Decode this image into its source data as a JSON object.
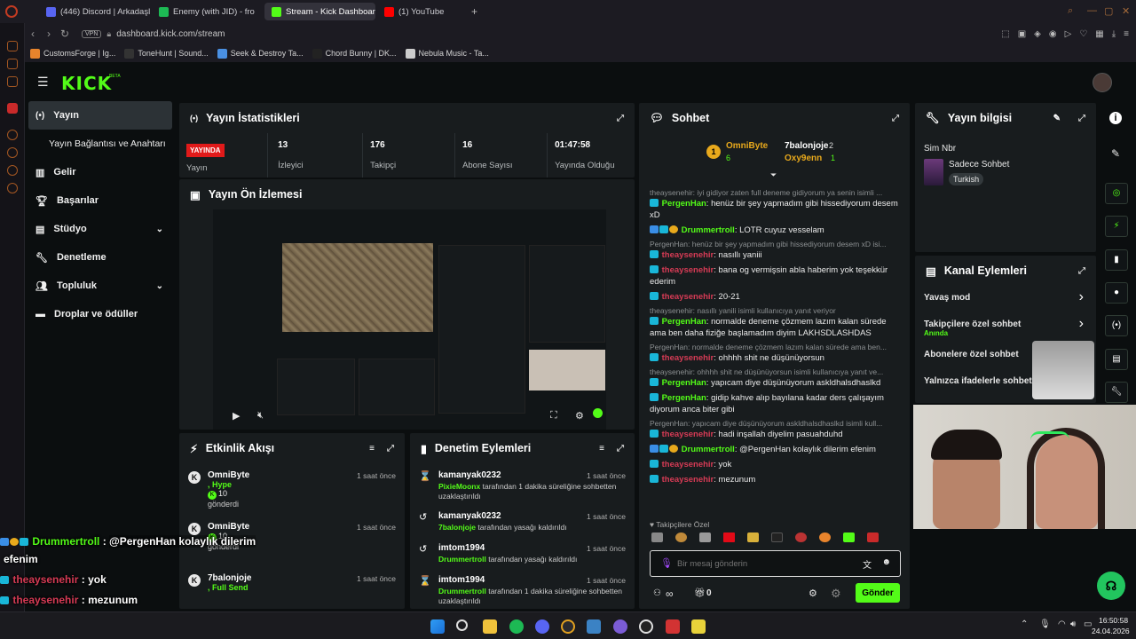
{
  "browser": {
    "tabs": [
      {
        "label": "(446) Discord | Arkadaşlar",
        "color": "#5865f2"
      },
      {
        "label": "Enemy (with JID) - fro",
        "color": "#1db954"
      },
      {
        "label": "Stream - Kick Dashboard",
        "color": "#53fc18"
      },
      {
        "label": "(1) YouTube",
        "color": "#ff0000"
      }
    ],
    "new_tab": "+",
    "url": "dashboard.kick.com/stream",
    "vpn": "VPN",
    "bookmarks": [
      "CustomsForge | Ig...",
      "ToneHunt | Sound...",
      "Seek & Destroy Ta...",
      "Chord Bunny | DK...",
      "Nebula Music - Ta..."
    ]
  },
  "kick": {
    "logo": "KICK",
    "beta": "BETA",
    "accent": "#53fc18"
  },
  "sidenav": {
    "items": [
      {
        "label": "Yayın",
        "icon": "broadcast-icon"
      },
      {
        "label": "Yayın Bağlantısı ve Anahtarı",
        "icon": ""
      },
      {
        "label": "Gelir",
        "icon": "chart-icon"
      },
      {
        "label": "Başarılar",
        "icon": "trophy-icon"
      },
      {
        "label": "Stüdyo",
        "icon": "studio-icon"
      },
      {
        "label": "Denetleme",
        "icon": "wrench-icon"
      },
      {
        "label": "Topluluk",
        "icon": "people-icon"
      },
      {
        "label": "Droplar ve ödüller",
        "icon": "gift-icon"
      }
    ]
  },
  "stats": {
    "title": "Yayın İstatistikleri",
    "live_badge": "YAYINDA",
    "live_label": "Yayın",
    "items": [
      {
        "value": "13",
        "label": "İzleyici"
      },
      {
        "value": "176",
        "label": "Takipçi"
      },
      {
        "value": "16",
        "label": "Abone Sayısı"
      },
      {
        "value": "01:47:58",
        "label": "Yayında Olduğu"
      }
    ]
  },
  "preview": {
    "title": "Yayın Ön İzlemesi"
  },
  "activity": {
    "title": "Etkinlik Akışı",
    "items": [
      {
        "user": "OmniByte",
        "action": ", Hype",
        "amount": "10",
        "suffix": "gönderdi",
        "time": "1 saat önce"
      },
      {
        "user": "OmniByte",
        "action": "",
        "amount": "10",
        "suffix": "gönderdi",
        "time": "1 saat önce"
      },
      {
        "user": "7balonjoje",
        "action": ", Full Send",
        "amount": "",
        "suffix": "",
        "time": "1 saat önce"
      }
    ]
  },
  "moderation": {
    "title": "Denetim Eylemleri",
    "items": [
      {
        "user": "kamanyak0232",
        "actor": "PixieMoonx",
        "text": "tarafından 1 dakika süreliğine sohbetten uzaklaştırıldı",
        "time": "1 saat önce"
      },
      {
        "user": "kamanyak0232",
        "actor": "7balonjoje",
        "text": "tarafından yasağı kaldırıldı",
        "time": "1 saat önce"
      },
      {
        "user": "imtom1994",
        "actor": "Drummertroll",
        "text": "tarafından yasağı kaldırıldı",
        "time": "1 saat önce"
      },
      {
        "user": "imtom1994",
        "actor": "Drummertroll",
        "text": "tarafından 1 dakika süreliğine sohbetten uzaklaştırıldı",
        "time": "1 saat önce"
      }
    ]
  },
  "chat": {
    "title": "Sohbet",
    "top": [
      {
        "rank": "1",
        "user": "OmniByte",
        "count": "6"
      },
      {
        "user": "7balonjoje",
        "count": "2"
      },
      {
        "user": "Oxy9enn",
        "count": "1"
      }
    ],
    "messages": [
      {
        "reply": "theaysenehir: iyi gidiyor zaten full deneme gidiyorum ya senin isimli ...",
        "user": "PergenHan",
        "color": "g",
        "text": "henüz bir şey yapmadım gibi hissediyorum desem xD"
      },
      {
        "reply": "",
        "user": "Drummertroll",
        "color": "g",
        "text": "LOTR cuyuz vesselam"
      },
      {
        "reply": "PergenHan: henüz bir şey yapmadım gibi hissediyorum desem xD isi...",
        "user": "theaysenehir",
        "color": "r",
        "text": "nasıllı yaniii"
      },
      {
        "reply": "",
        "user": "theaysenehir",
        "color": "r",
        "text": "bana og vermişsin abla haberim yok teşekkür ederim"
      },
      {
        "reply": "",
        "user": "theaysenehir",
        "color": "r",
        "text": "20-21"
      },
      {
        "reply": "theaysenehir: nasıllı yanili isimli kullanıcıya yanıt veriyor",
        "user": "PergenHan",
        "color": "g",
        "text": "normalde deneme çözmem lazım kalan sürede ama ben daha fiziğe başlamadım diyim LAKHSDLASHDAS"
      },
      {
        "reply": "PergenHan: normalde deneme çözmem lazım kalan sürede ama ben...",
        "user": "theaysenehir",
        "color": "r",
        "text": "ohhhh shit ne düşünüyorsun"
      },
      {
        "reply": "theaysenehir: ohhhh shit ne düşünüyorsun isimli kullanıcıya yanıt ve...",
        "user": "PergenHan",
        "color": "g",
        "text": "yapıcam diye düşünüyorum askldhalsdhaslkd"
      },
      {
        "reply": "",
        "user": "PergenHan",
        "color": "g",
        "text": "gidip kahve alıp bayılana kadar ders çalışayım diyorum anca biter gibi"
      },
      {
        "reply": "PergenHan: yapıcam diye düşünüyorum askldhalsdhaslkd isimli kull...",
        "user": "theaysenehir",
        "color": "r",
        "text": "hadi inşallah diyelim pasuahduhd"
      },
      {
        "reply": "",
        "user": "Drummertroll",
        "color": "g",
        "text": "@PergenHan kolaylık dilerim efenim"
      },
      {
        "reply": "",
        "user": "theaysenehir",
        "color": "r",
        "text": "yok"
      },
      {
        "reply": "",
        "user": "theaysenehir",
        "color": "r",
        "text": "mezunum"
      }
    ],
    "followers_only": "Takipçilere Özel",
    "placeholder": "Bir mesaj gönderin",
    "infinity_count": "∞",
    "gift_count": "0",
    "send": "Gönder"
  },
  "stream_info": {
    "title": "Yayın bilgisi",
    "stream_name": "Sim Nbr",
    "category": "Sadece Sohbet",
    "tag": "Turkish"
  },
  "channel_actions": {
    "title": "Kanal Eylemleri",
    "items": [
      {
        "label": "Yavaş mod",
        "sub": ""
      },
      {
        "label": "Takipçilere özel sohbet",
        "sub": "Anında"
      },
      {
        "label": "Abonelere özel sohbet",
        "sub": ""
      },
      {
        "label": "Yalnızca ifadelerle sohbet",
        "sub": ""
      }
    ]
  },
  "overlay_chat": [
    {
      "user": "Drummertroll",
      "color": "#53fc18",
      "text": "@PergenHan kolaylık dilerim",
      "cont": "efenim"
    },
    {
      "user": "theaysenehir",
      "color": "#d63b55",
      "text": "yok"
    },
    {
      "user": "theaysenehir",
      "color": "#d63b55",
      "text": "mezunum"
    }
  ],
  "taskbar": {
    "time": "16:50:58",
    "date": "24.04.2026"
  }
}
